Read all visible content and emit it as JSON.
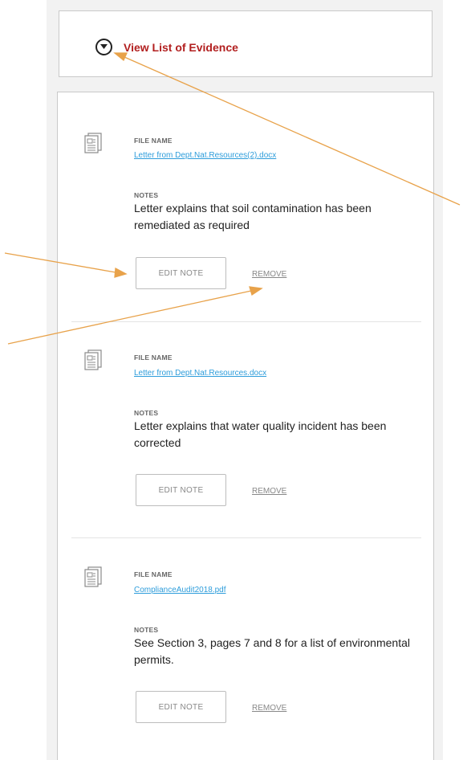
{
  "header": {
    "title": "View List of Evidence",
    "toggle_icon": "chevron-down-icon"
  },
  "evidence": [
    {
      "file_label": "FILE NAME",
      "file_name": "Letter from Dept.Nat.Resources(2).docx",
      "notes_label": "NOTES",
      "notes": "Letter explains that soil contamination has been remediated as required",
      "edit_label": "EDIT NOTE",
      "remove_label": "REMOVE"
    },
    {
      "file_label": "FILE NAME",
      "file_name": "Letter from Dept.Nat.Resources.docx",
      "notes_label": "NOTES",
      "notes": "Letter explains that water quality incident has been corrected",
      "edit_label": "EDIT NOTE",
      "remove_label": "REMOVE"
    },
    {
      "file_label": "FILE NAME",
      "file_name": "ComplianceAudit2018.pdf",
      "notes_label": "NOTES",
      "notes": "See Section 3, pages 7 and 8 for a list of environmental permits.",
      "edit_label": "EDIT NOTE",
      "remove_label": "REMOVE"
    }
  ],
  "colors": {
    "title_red": "#b21f1f",
    "link_blue": "#2e9ddb",
    "callout_orange": "#e8a24a"
  }
}
